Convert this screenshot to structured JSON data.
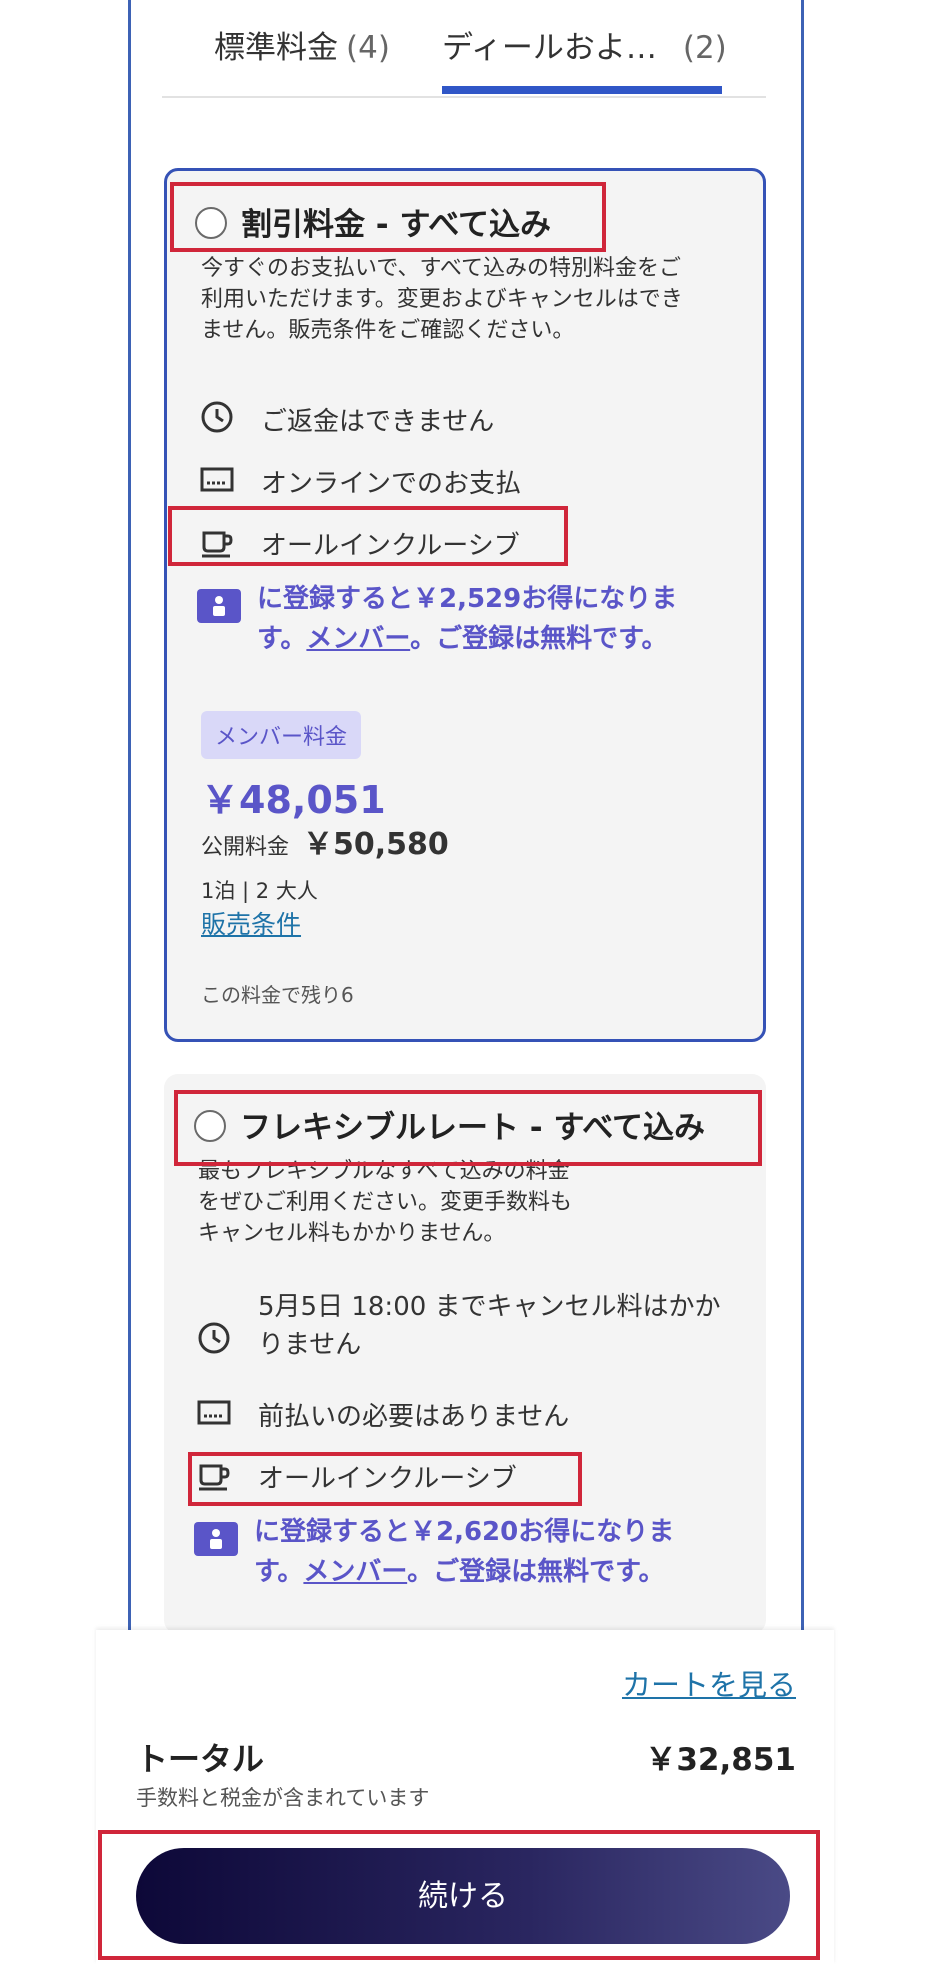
{
  "tabs": [
    {
      "label": "標準料金",
      "count": "(4)"
    },
    {
      "label": "ディールおよ…",
      "count": "(2)"
    }
  ],
  "rates": [
    {
      "title": "割引料金 - すべて込み",
      "description": "今すぐのお支払いで、すべて込みの特別料金をご利用いただけます。変更およびキャンセルはできません。販売条件をご確認ください。",
      "features": [
        {
          "icon": "clock-icon",
          "text": "ご返金はできません"
        },
        {
          "icon": "card-icon",
          "text": "オンラインでのお支払"
        },
        {
          "icon": "cup-icon",
          "text": "オールインクルーシブ"
        }
      ],
      "promo_line1": "に登録すると￥2,529お得になりま",
      "promo_pre": "す。",
      "promo_link": "メンバー",
      "promo_post": "。ご登録は無料です。",
      "badge": "メンバー料金",
      "member_price": "￥48,051",
      "public_price_label": "公開料金",
      "public_price": "￥50,580",
      "stay": "1泊 | 2 大人",
      "terms_link": "販売条件",
      "remaining": "この料金で残り6"
    },
    {
      "title": "フレキシブルレート - すべて込み",
      "description": "最もフレキシブルなすべて込みの料金をぜひご利用ください。変更手数料もキャンセル料もかかりません。",
      "features": [
        {
          "icon": "clock-icon",
          "text": "5月5日 18:00 までキャンセル料はかかりません"
        },
        {
          "icon": "card-icon",
          "text": "前払いの必要はありません"
        },
        {
          "icon": "cup-icon",
          "text": "オールインクルーシブ"
        }
      ],
      "promo_line1": "に登録すると￥2,620お得になりま",
      "promo_pre": "す。",
      "promo_link": "メンバー",
      "promo_post": "。ご登録は無料です。"
    }
  ],
  "footer": {
    "cart_link": "カートを見る",
    "total_label": "トータル",
    "total_sub": "手数料と税金が含まれています",
    "total_value": "￥32,851",
    "cta": "続ける"
  }
}
